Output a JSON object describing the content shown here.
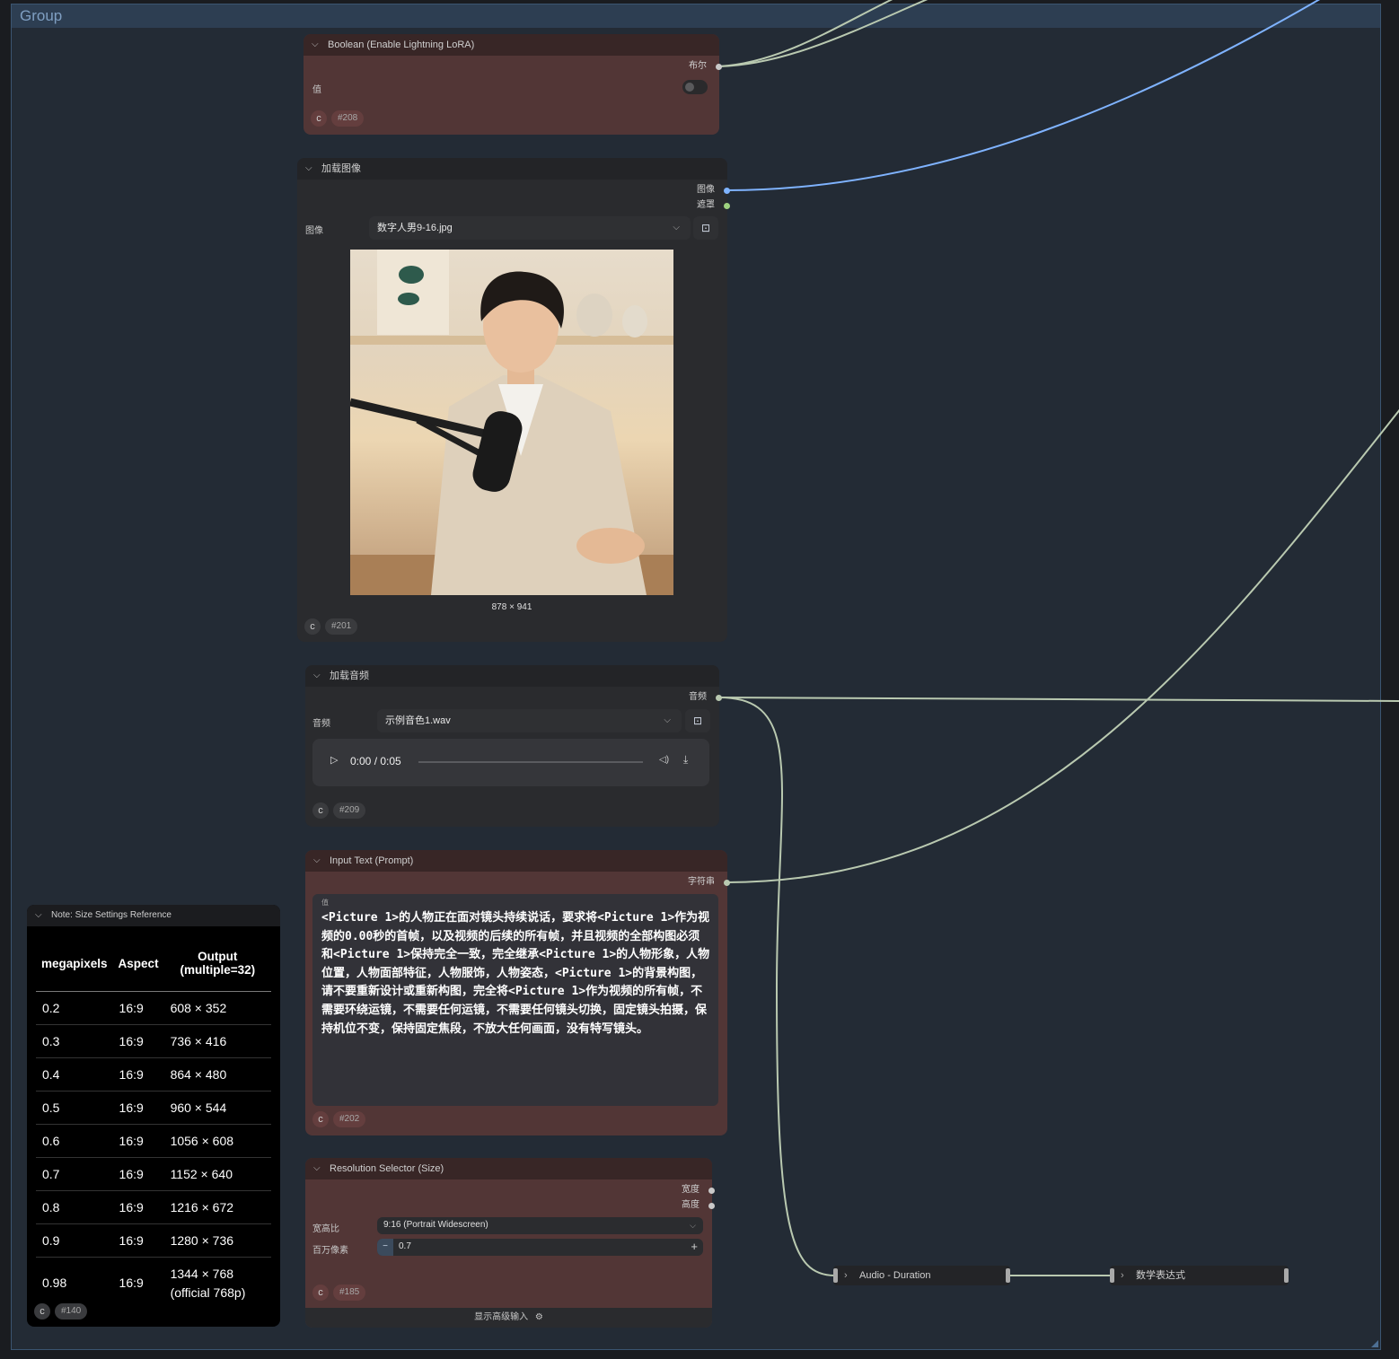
{
  "group": {
    "title": "Group"
  },
  "boolean_node": {
    "title": "Boolean (Enable Lightning LoRA)",
    "output_label": "布尔",
    "widget_label": "值",
    "value": false,
    "id": "#208"
  },
  "load_image_node": {
    "title": "加载图像",
    "outputs": [
      "图像",
      "遮罩"
    ],
    "widget_label": "图像",
    "filename": "数字人男9-16.jpg",
    "image_size": "878 × 941",
    "id": "#201"
  },
  "load_audio_node": {
    "title": "加载音频",
    "output_label": "音频",
    "widget_label": "音频",
    "filename": "示例音色1.wav",
    "time": "0:00 / 0:05",
    "id": "#209"
  },
  "input_text_node": {
    "title": "Input Text (Prompt)",
    "output_label": "字符串",
    "widget_label": "值",
    "text": "<Picture 1>的人物正在面对镜头持续说话，要求将<Picture 1>作为视频的0.00秒的首帧，以及视频的后续的所有帧，并且视频的全部构图必须和<Picture 1>保持完全一致，完全继承<Picture 1>的人物形象，人物位置，人物面部特征，人物服饰，人物姿态，<Picture 1>的背景构图，请不要重新设计或重新构图，完全将<Picture 1>作为视频的所有帧，不需要环绕运镜，不需要任何运镜，不需要任何镜头切换，固定镜头拍摄，保持机位不变，保持固定焦段，不放大任何画面，没有特写镜头。",
    "id": "#202"
  },
  "resolution_node": {
    "title": "Resolution Selector (Size)",
    "outputs": [
      "宽度",
      "高度"
    ],
    "aspect_label": "宽高比",
    "aspect_value": "9:16 (Portrait Widescreen)",
    "megapixel_label": "百万像素",
    "megapixel_value": "0.7",
    "id": "#185",
    "advanced_label": "显示高级输入"
  },
  "note_node": {
    "title": "Note: Size Settings Reference",
    "headers": [
      "megapixels",
      "Aspect",
      "Output (multiple=32)"
    ],
    "rows": [
      [
        "0.2",
        "16:9",
        "608 × 352"
      ],
      [
        "0.3",
        "16:9",
        "736 × 416"
      ],
      [
        "0.4",
        "16:9",
        "864 × 480"
      ],
      [
        "0.5",
        "16:9",
        "960 × 544"
      ],
      [
        "0.6",
        "16:9",
        "1056 × 608"
      ],
      [
        "0.7",
        "16:9",
        "1152 × 640"
      ],
      [
        "0.8",
        "16:9",
        "1216 × 672"
      ],
      [
        "0.9",
        "16:9",
        "1280 × 736"
      ],
      [
        "0.98",
        "16:9",
        "1344 × 768 (official 768p)"
      ]
    ],
    "id": "#140"
  },
  "collapsed_nodes": [
    "Audio - Duration",
    "数学表达式"
  ],
  "colors": {
    "group_bg": "#232b35",
    "group_border": "#3b5571",
    "node_red": "#523636",
    "node_dark": "#2a2b2e",
    "link_image": "#7fb3ff",
    "link_default": "#b9c9b0"
  },
  "icons": {
    "collapse": "chevron-down-icon",
    "expand": "chevron-right-icon",
    "upload": "folder-upload-icon",
    "play": "play-icon",
    "volume": "volume-icon",
    "download": "download-icon",
    "minus": "minus-icon",
    "plus": "plus-icon",
    "node_logo": "comfy-logo-icon",
    "settings": "sliders-icon"
  }
}
